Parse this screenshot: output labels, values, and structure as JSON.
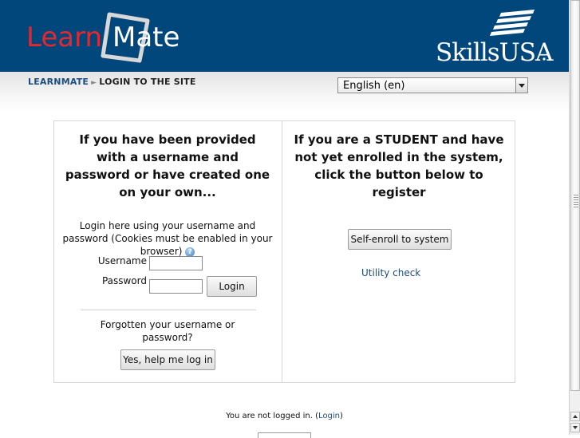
{
  "header": {
    "logo_text_learn": "Learn",
    "logo_text_mate": "Mate",
    "partner_logo_text": "SkillsUSA",
    "brand_red": "#e4282f",
    "brand_blue": "#02477c"
  },
  "breadcrumb": {
    "home": "LEARNMATE",
    "separator": "►",
    "current": "LOGIN TO THE SITE"
  },
  "language": {
    "selected": "English (en)"
  },
  "login_panel": {
    "title": "If you have been provided with a username and password or have created one on your own...",
    "description": "Login here using your username and password (Cookies must be enabled in your browser)",
    "help_icon": "help-icon",
    "username_label": "Username",
    "password_label": "Password",
    "username_value": "",
    "password_value": "",
    "login_button": "Login",
    "forgot_text": "Forgotten your username or password?",
    "help_button": "Yes, help me log in"
  },
  "register_panel": {
    "title": "If you are a STUDENT and have not yet enrolled in the system, click the button below to register",
    "enroll_button": "Self-enroll to system",
    "utility_link": "Utility check"
  },
  "footer": {
    "status": "You are not logged in.",
    "login_link": "Login"
  }
}
